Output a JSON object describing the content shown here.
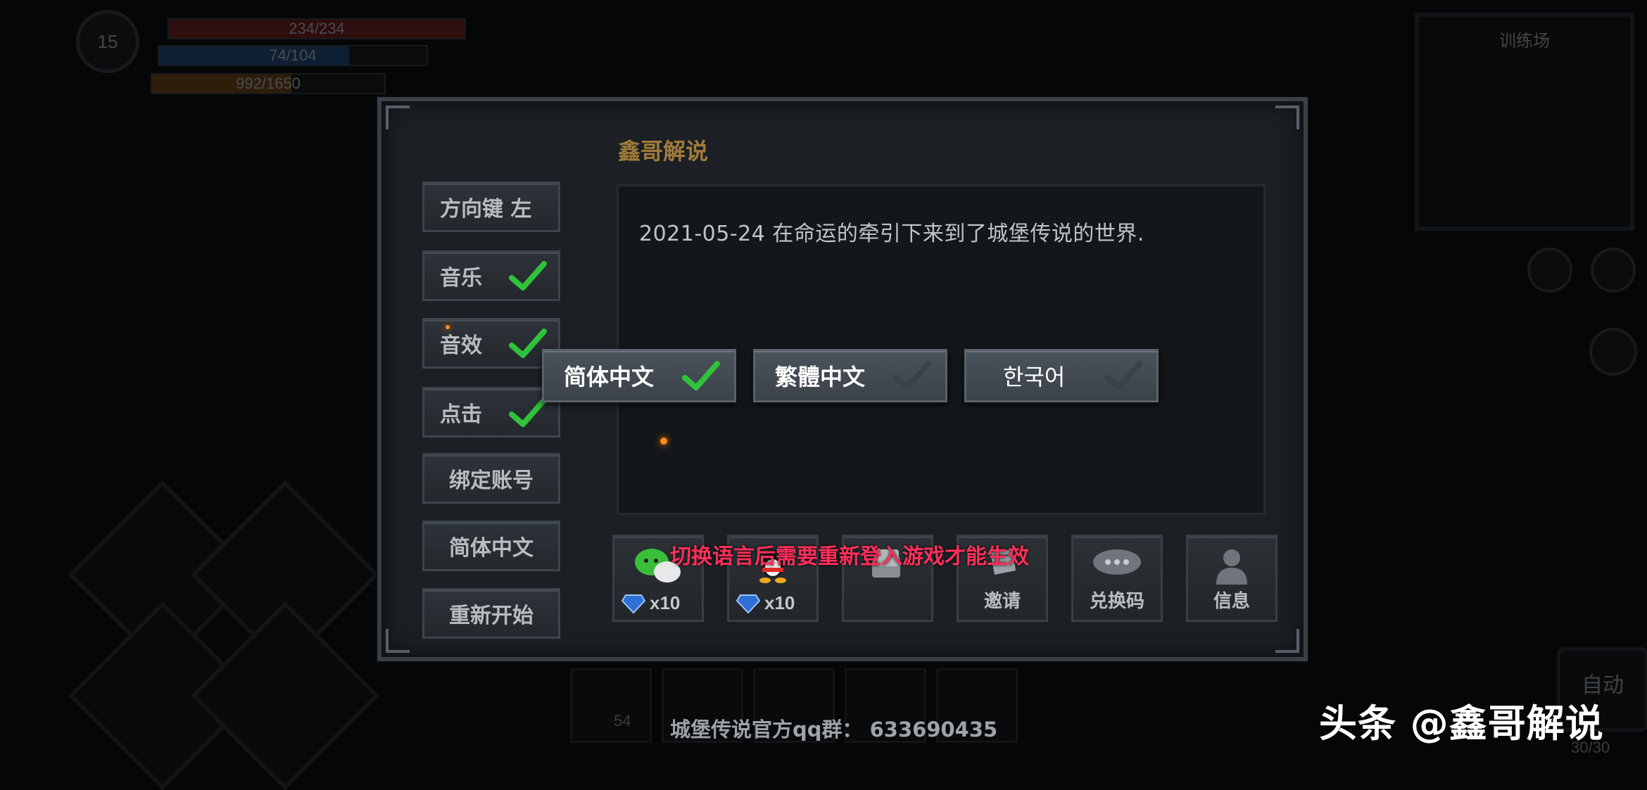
{
  "hud": {
    "level": "15",
    "hp": "234/234",
    "mp": "74/104",
    "exp": "992/1650",
    "minimap_title": "训练场",
    "auto_label": "自动",
    "bag_count": "30/30",
    "hotbar_count": "54"
  },
  "dialog": {
    "title": "鑫哥解说",
    "log_text": "2021-05-24 在命运的牵引下来到了城堡传说的世界.",
    "settings": [
      {
        "label": "方向键 左",
        "checked": null
      },
      {
        "label": "音乐",
        "checked": true
      },
      {
        "label": "音效",
        "checked": true
      },
      {
        "label": "点击",
        "checked": true
      },
      {
        "label": "绑定账号",
        "checked": null
      },
      {
        "label": "简体中文",
        "checked": null
      },
      {
        "label": "重新开始",
        "checked": null
      }
    ],
    "languages": [
      {
        "label": "简体中文",
        "selected": true
      },
      {
        "label": "繁體中文",
        "selected": false
      },
      {
        "label": "한국어",
        "selected": false
      }
    ],
    "warning": "切换语言后需要重新登入游戏才能生效",
    "share_buttons": [
      {
        "icon": "wechat-icon",
        "reward": "x10"
      },
      {
        "icon": "qq-icon",
        "reward": "x10"
      },
      {
        "icon": "share-icon",
        "caption": ""
      },
      {
        "icon": "invite-icon",
        "caption": "邀请"
      },
      {
        "icon": "redeem-code-icon",
        "caption": "兑换码"
      },
      {
        "icon": "info-user-icon",
        "caption": "信息"
      }
    ]
  },
  "footer": {
    "qq_group": "城堡传说官方qq群：  633690435"
  },
  "watermark": "头条 @鑫哥解说",
  "colors": {
    "check_active": "#2fc23a",
    "check_inactive": "#3b4148",
    "title_gold": "#a07a3a",
    "warning_red": "#ff2f5a"
  }
}
